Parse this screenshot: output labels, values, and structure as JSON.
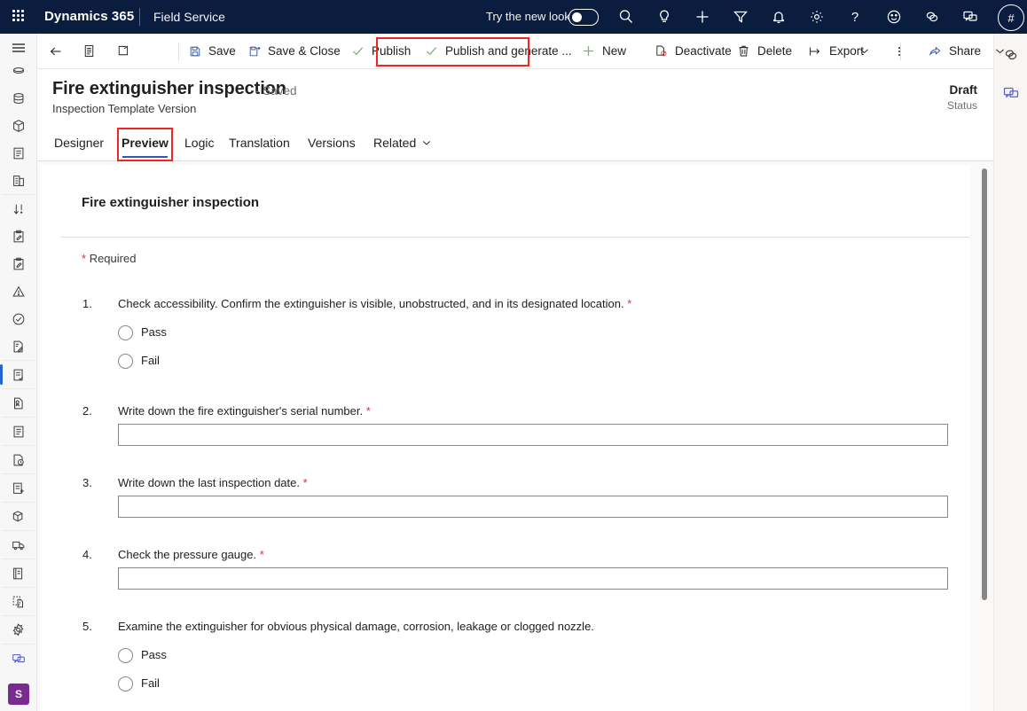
{
  "topbar": {
    "brand": "Dynamics 365",
    "app": "Field Service",
    "new_look_label": "Try the new look",
    "waffle_icon": "app-launcher-icon",
    "icons": [
      {
        "name": "search-icon"
      },
      {
        "name": "lightbulb-icon"
      },
      {
        "name": "plus-icon"
      },
      {
        "name": "filter-icon"
      },
      {
        "name": "bell-icon"
      },
      {
        "name": "gear-icon"
      },
      {
        "name": "question-icon"
      },
      {
        "name": "smiley-icon"
      },
      {
        "name": "copilot-icon"
      },
      {
        "name": "feedback-icon"
      }
    ],
    "avatar_text": "#"
  },
  "command_bar": {
    "back_icon": "back-arrow-icon",
    "form_selector_icon": "form-selector-icon",
    "popout_icon": "open-in-new-window-icon",
    "items": [
      {
        "label": "Save",
        "icon": "save-icon"
      },
      {
        "label": "Save & Close",
        "icon": "save-and-close-icon"
      },
      {
        "label": "Publish",
        "icon": "checkmark-icon"
      },
      {
        "label": "Publish and generate ...",
        "icon": "checkmark-icon"
      },
      {
        "label": "New",
        "icon": "plus-icon"
      },
      {
        "label": "Deactivate",
        "icon": "deactivate-icon"
      },
      {
        "label": "Delete",
        "icon": "trash-icon"
      },
      {
        "label": "Export",
        "icon": "export-icon"
      },
      {
        "label": "Share",
        "icon": "share-icon"
      }
    ],
    "overflow_icon": "more-vertical-icon",
    "chevron_icon": "chevron-down-icon",
    "highlight_color": "#ee2722"
  },
  "record": {
    "title": "Fire extinguisher inspection",
    "saved_state": "- Saved",
    "entity": "Inspection Template Version",
    "status_value": "Draft",
    "status_label": "Status"
  },
  "tabs": {
    "items": [
      {
        "label": "Designer"
      },
      {
        "label": "Preview"
      },
      {
        "label": "Logic"
      },
      {
        "label": "Translation"
      },
      {
        "label": "Versions"
      },
      {
        "label": "Related"
      }
    ],
    "selected": "Preview",
    "related_chevron_icon": "chevron-down-icon"
  },
  "form": {
    "title": "Fire extinguisher inspection",
    "required_star": "*",
    "required_note": "Required",
    "questions": [
      {
        "number": "1.",
        "text": "Check accessibility. Confirm the extinguisher is visible, unobstructed, and in its designated location.",
        "star": "*",
        "option1": "Pass",
        "option2": "Fail"
      },
      {
        "number": "2.",
        "text": "Write down the fire extinguisher's serial number.",
        "star": "*",
        "value": ""
      },
      {
        "number": "3.",
        "text": "Write down the last inspection date.",
        "star": "*",
        "value": ""
      },
      {
        "number": "4.",
        "text": "Check the pressure gauge.",
        "star": "*",
        "value": ""
      },
      {
        "number": "5.",
        "text": "Examine the extinguisher for obvious physical damage, corrosion, leakage or clogged nozzle.",
        "star": "",
        "option1": "Pass",
        "option2": "Fail"
      }
    ]
  },
  "left_rail": {
    "menu_icon": "hamburger-menu-icon",
    "groups": [
      [
        "pill-icon",
        "database-icon",
        "package-icon",
        "document-icon",
        "building-icon"
      ],
      [
        "sort-descending-icon",
        "clipboard-edit-icon",
        "clipboard-edit-alt-icon",
        "warning-triangle-icon",
        "check-circle-icon",
        "document-edit-icon"
      ],
      [
        "inspection-document-icon"
      ],
      [
        "document-badge-icon"
      ],
      [
        "document-lines-icon"
      ],
      [
        "document-clock-icon"
      ],
      [
        "document-add-icon"
      ],
      [
        "package-add-icon"
      ],
      [
        "truck-icon"
      ],
      [
        "documents-icon"
      ],
      [
        "dashed-document-icon"
      ],
      [
        "settings-gear-icon"
      ],
      [
        "feedback-chat-icon"
      ]
    ],
    "selected": "inspection-document-icon",
    "avatar_text": "S",
    "avatar_color": "#7a2b8f"
  },
  "right_rail": {
    "items": [
      {
        "name": "copilot-icon"
      },
      {
        "name": "feedback-chat-icon"
      }
    ]
  }
}
